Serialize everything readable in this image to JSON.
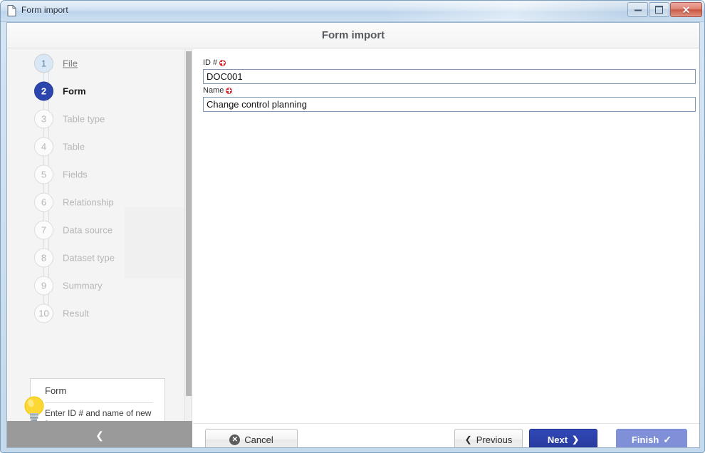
{
  "window": {
    "title": "Form import",
    "title_icon": "document-icon",
    "buttons": {
      "minimize": "minimize-icon",
      "maximize": "maximize-icon",
      "close": "✕"
    }
  },
  "header": {
    "title": "Form import"
  },
  "sidebar": {
    "steps": [
      {
        "number": "1",
        "label": "File",
        "state": "done"
      },
      {
        "number": "2",
        "label": "Form",
        "state": "active"
      },
      {
        "number": "3",
        "label": "Table type",
        "state": "inactive"
      },
      {
        "number": "4",
        "label": "Table",
        "state": "inactive"
      },
      {
        "number": "5",
        "label": "Fields",
        "state": "inactive"
      },
      {
        "number": "6",
        "label": "Relationship",
        "state": "inactive"
      },
      {
        "number": "7",
        "label": "Data source",
        "state": "inactive"
      },
      {
        "number": "8",
        "label": "Dataset type",
        "state": "inactive"
      },
      {
        "number": "9",
        "label": "Summary",
        "state": "inactive"
      },
      {
        "number": "10",
        "label": "Result",
        "state": "inactive"
      }
    ],
    "tip": {
      "icon": "lightbulb-icon",
      "title": "Form",
      "body": "Enter ID # and name of new form."
    },
    "collapse": {
      "icon": "chevron-left-icon",
      "glyph": "❮"
    }
  },
  "main": {
    "fields": [
      {
        "label": "ID #",
        "required": true,
        "value": "DOC001",
        "placeholder": ""
      },
      {
        "label": "Name",
        "required": true,
        "value": "Change control planning",
        "placeholder": ""
      }
    ]
  },
  "footer": {
    "cancel": {
      "label": "Cancel",
      "icon": "close-circle-icon",
      "glyph": "✕"
    },
    "previous": {
      "label": "Previous",
      "icon": "chevron-left-icon",
      "glyph": "❮"
    },
    "next": {
      "label": "Next",
      "icon": "chevron-right-icon",
      "glyph": "❯"
    },
    "finish": {
      "label": "Finish",
      "icon": "check-icon",
      "glyph": "✓"
    }
  },
  "colors": {
    "accent_blue": "#2b45ac",
    "disabled_blue": "#7f90d9",
    "required_red": "#d8262b",
    "step_done_fill": "#d9e8f7",
    "sidebar_bg": "#f4f4f4",
    "collapse_bar": "#9a9a9a",
    "input_border": "#7d9ab4"
  }
}
